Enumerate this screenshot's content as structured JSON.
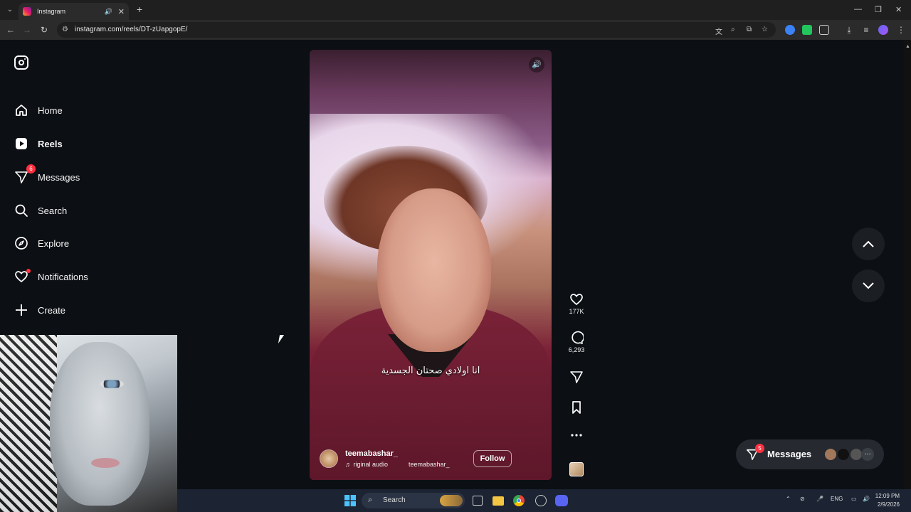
{
  "browser": {
    "tab_title": "Instagram",
    "url": "instagram.com/reels/DT-zUapgopE/",
    "new_tab_label": "+"
  },
  "sidebar": {
    "items": [
      {
        "label": "Home",
        "icon": "home-icon"
      },
      {
        "label": "Reels",
        "icon": "reels-icon"
      },
      {
        "label": "Messages",
        "icon": "messages-icon",
        "badge": "6"
      },
      {
        "label": "Search",
        "icon": "search-icon"
      },
      {
        "label": "Explore",
        "icon": "compass-icon"
      },
      {
        "label": "Notifications",
        "icon": "heart-icon"
      },
      {
        "label": "Create",
        "icon": "plus-icon"
      }
    ]
  },
  "reel": {
    "caption": "انا اولادي صحتان الجسدية",
    "username": "teemabashar_",
    "audio_label": "riginal audio",
    "audio_author": "teemabashar_",
    "follow_label": "Follow",
    "likes": "177K",
    "comments": "6,293"
  },
  "messages_pill": {
    "label": "Messages",
    "badge": "5"
  },
  "taskbar": {
    "search_label": "Search",
    "language": "ENG",
    "time": "12:09 PM",
    "date": "2/9/2026"
  },
  "colors": {
    "accent_badge": "#ff3040",
    "page_bg": "#0c0f14"
  }
}
